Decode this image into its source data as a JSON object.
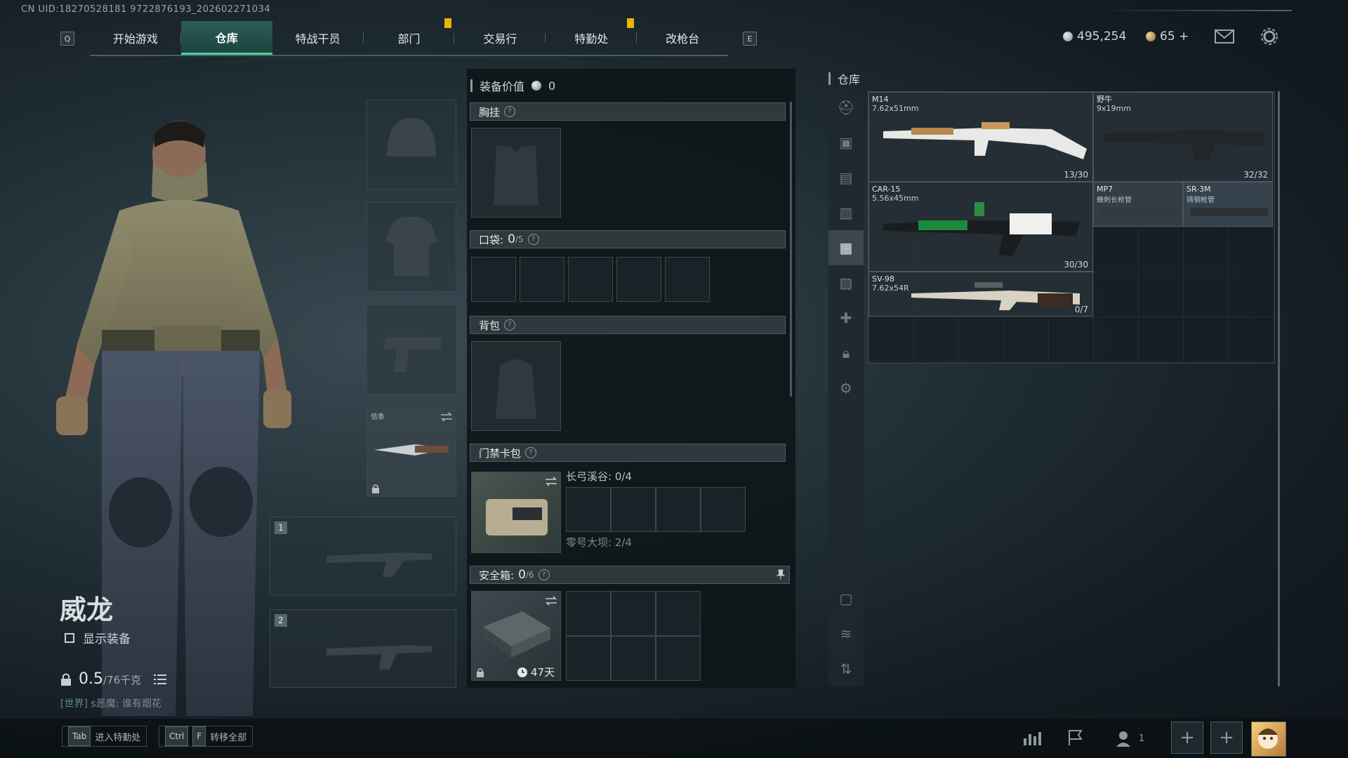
{
  "uid": "CN UID:18270528181 9722876193_202602271034",
  "nav": {
    "left_key": "Q",
    "right_key": "E",
    "tabs": [
      "开始游戏",
      "仓库",
      "特战干员",
      "部门",
      "交易行",
      "特勤处",
      "改枪台"
    ],
    "active_index": 1
  },
  "currency": {
    "silver": "495,254",
    "gold": "65 +"
  },
  "character": {
    "name": "威龙",
    "show_equipment_label": "显示装备",
    "weight_value": "0.5",
    "weight_max": "/76千克",
    "chat_channel": "[世界]",
    "chat_text": "s恶魔: 谁有烟花"
  },
  "equipment": {
    "melee_label": "信条",
    "weapon_slot_1": "1",
    "weapon_slot_2": "2"
  },
  "gear": {
    "value_label": "装备价值",
    "value": "0",
    "chest_rig": "胸挂",
    "pockets_label": "口袋:",
    "pockets_count": "0",
    "pockets_max": "/5",
    "backpack": "背包",
    "keycard_label": "门禁卡包",
    "keycard_area1": "长弓溪谷: 0/4",
    "keycard_area2": "零号大坝: 2/4",
    "safebox_label": "安全箱:",
    "safebox_count": "0",
    "safebox_max": "/6",
    "safebox_timer": "47天"
  },
  "warehouse": {
    "title": "仓库",
    "items": [
      {
        "name": "M14",
        "caliber": "7.62x51mm",
        "ammo": "13/30"
      },
      {
        "name": "野牛",
        "caliber": "9x19mm",
        "ammo": "32/32"
      },
      {
        "name": "CAR-15",
        "caliber": "5.56x45mm",
        "ammo": "30/30"
      },
      {
        "name": "MP7",
        "caliber": "蜂刺长枪管"
      },
      {
        "name": "SR-3M",
        "caliber": "铸钢枪管"
      },
      {
        "name": "SV-98",
        "caliber": "7.62x54R",
        "ammo": "0/7"
      }
    ]
  },
  "bottom": {
    "tab_key": "Tab",
    "tab_label": "进入特勤处",
    "ctrl_key": "Ctrl",
    "f_key": "F",
    "transfer_label": "转移全部",
    "party_count": "1"
  },
  "colors": {
    "accent": "#3ddc9a",
    "active_tab": "#2b5c56",
    "gold_mark": "#e8b400"
  }
}
